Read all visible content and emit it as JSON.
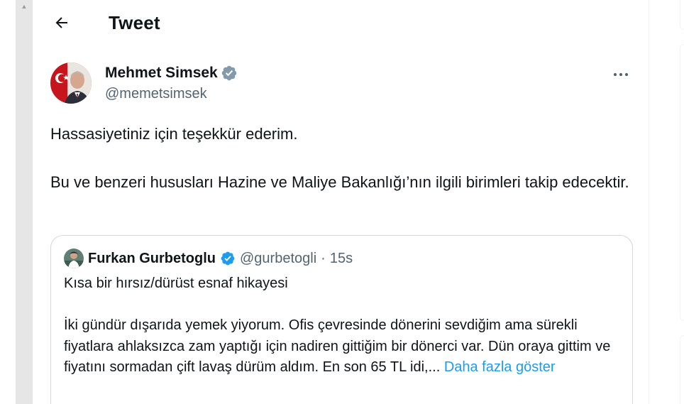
{
  "header": {
    "title": "Tweet",
    "back_icon": "arrow-left-icon"
  },
  "tweet": {
    "author_name": "Mehmet Simsek",
    "author_handle": "@memetsimsek",
    "verified_color": "#829aab",
    "text_paragraph_1": "Hassasiyetiniz için teşekkür ederim.",
    "text_paragraph_2": "Bu ve benzeri hususları Hazine ve Maliye Bakanlığı’nın ilgili birimleri takip edecektir."
  },
  "quoted_tweet": {
    "author_name": "Furkan Gurbetoglu",
    "author_handle": "@gurbetogli",
    "separator": "·",
    "time": "15s",
    "verified_color": "#1d9bf0",
    "paragraph_1": "Kısa bir hırsız/dürüst esnaf hikayesi",
    "paragraph_2": "İki gündür dışarıda yemek yiyorum. Ofis çevresinde dönerini sevdiğim ama sürekli fiyatlara ahlaksızca zam yaptığı için nadiren gittiğim bir dönerci var. Dün oraya gittim ve fiyatını sormadan çift lavaş dürüm aldım. En son 65 TL idi,...",
    "show_more": "Daha fazla göster"
  },
  "colors": {
    "text_primary": "#0f1419",
    "text_secondary": "#536471",
    "link": "#1d9bf0",
    "border": "#cfd9de"
  }
}
